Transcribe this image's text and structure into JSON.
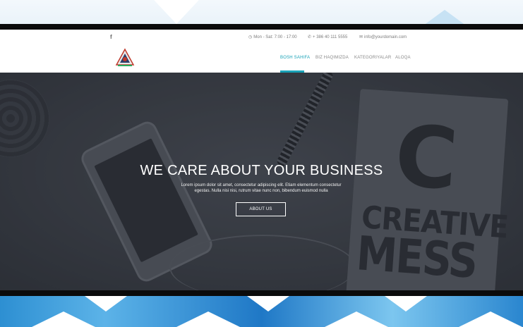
{
  "topbar": {
    "social_icon": "facebook-icon",
    "hours": "Mon - Sat: 7:00 - 17:00",
    "phone": "+ 386 40 111 5555",
    "email": "info@yourdomain.com"
  },
  "nav": {
    "items": [
      "BOSH SAHIFA",
      "BIZ HAQIMIZDA",
      "KATEGORIYALAR",
      "ALOQA"
    ],
    "active_index": 0,
    "accent_color": "#1aa3b8"
  },
  "hero": {
    "title": "WE CARE ABOUT YOUR BUSINESS",
    "subtitle": "Lorem ipsum dolor sit amet, consectetur adipiscing elit. Etiam elementum consectetur egestas. Nulla nisi nisi, rutrum vitae nunc non, bibendum euismod nulla",
    "button_label": "ABOUT US",
    "image_text": {
      "letter": "C",
      "line1": "CREATIVE",
      "line2": "MESS"
    }
  }
}
